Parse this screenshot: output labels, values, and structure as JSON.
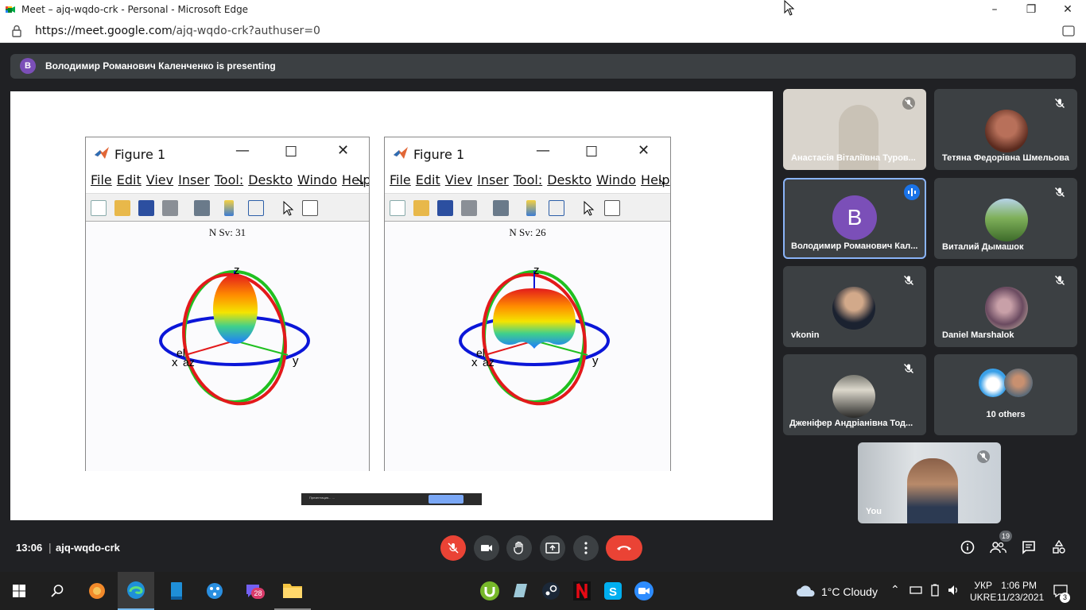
{
  "browser": {
    "window_title": "Meet – ajq-wqdo-crk - Personal - Microsoft Edge",
    "url_host": "https://meet.google.com",
    "url_path": "/ajq-wqdo-crk?authuser=0"
  },
  "presenting": {
    "avatar_letter": "В",
    "text": "Володимир Романович Каленченко is presenting"
  },
  "figures": [
    {
      "title": "Figure 1",
      "menu": [
        "File",
        "Edit",
        "Viev",
        "Inser",
        "Tool:",
        "Deskto",
        "Windo",
        "Help"
      ],
      "plot_label": "N Sv: 31",
      "axis_labels": {
        "z": "z",
        "x": "x",
        "y": "y",
        "el": "el",
        "az": "az"
      }
    },
    {
      "title": "Figure 1",
      "menu": [
        "File",
        "Edit",
        "Viev",
        "Inser",
        "Tool:",
        "Deskto",
        "Windo",
        "Help"
      ],
      "plot_label": "N Sv: 26",
      "axis_labels": {
        "z": "z",
        "x": "x",
        "y": "y",
        "el": "el",
        "az": "az"
      }
    }
  ],
  "notice": {
    "text": "Презентация... ...",
    "button": "",
    "link": ""
  },
  "participants": [
    {
      "name": "Анастасія Віталіївна Туров...",
      "muted": true
    },
    {
      "name": "Тетяна Федорівна Шмельова",
      "muted": true
    },
    {
      "name": "Володимир Романович Кал...",
      "avatar_letter": "В",
      "speaking": true
    },
    {
      "name": "Виталий Дымашок",
      "muted": true
    },
    {
      "name": "vkonin",
      "muted": true
    },
    {
      "name": "Daniel Marshalok",
      "muted": true
    },
    {
      "name": "Дженіфер Андріанівна Тод...",
      "muted": true
    },
    {
      "name": "10 others"
    },
    {
      "name": "You",
      "muted": true
    }
  ],
  "meetbar": {
    "time": "13:06",
    "code": "ajq-wqdo-crk",
    "people_count": "19"
  },
  "taskbar": {
    "weather": "1°C  Cloudy",
    "lang_top": "УКР",
    "lang_bottom": "UKRE",
    "time": "1:06 PM",
    "date": "11/23/2021",
    "viber_badge": "28",
    "notif_count": "3"
  },
  "colors": {
    "mic_off_red": "#ea4335",
    "speaking_blue": "#1a73e8",
    "avatar_purple": "#7b4fb8",
    "tile_bg": "#3c4043"
  }
}
